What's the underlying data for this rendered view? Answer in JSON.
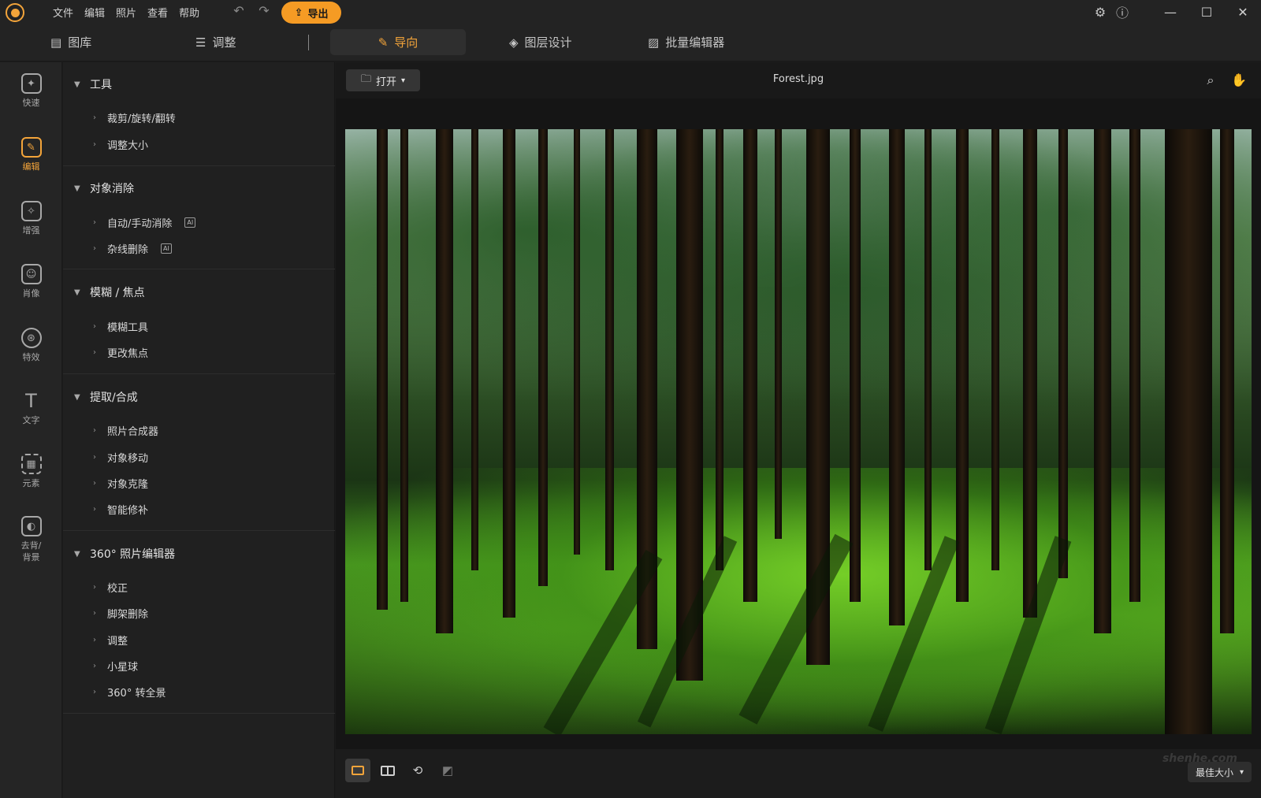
{
  "menu": {
    "items": [
      "文件",
      "编辑",
      "照片",
      "查看",
      "帮助"
    ],
    "export_label": "导出"
  },
  "tabs": [
    {
      "label": "图库",
      "icon": "library-icon"
    },
    {
      "label": "调整",
      "icon": "sliders-icon"
    },
    {
      "label": "导向",
      "icon": "magic-wand-icon",
      "active": true
    },
    {
      "label": "图层设计",
      "icon": "layers-icon"
    },
    {
      "label": "批量编辑器",
      "icon": "batch-images-icon"
    }
  ],
  "rail": [
    {
      "label": "快速",
      "icon": "quick-magic-icon"
    },
    {
      "label": "编辑",
      "icon": "edit-image-icon",
      "active": true
    },
    {
      "label": "增强",
      "icon": "enhance-icon"
    },
    {
      "label": "肖像",
      "icon": "portrait-icon"
    },
    {
      "label": "特效",
      "icon": "effects-icon"
    },
    {
      "label": "文字",
      "icon": "text-icon"
    },
    {
      "label": "元素",
      "icon": "elements-icon"
    },
    {
      "label": "去背/\n背景",
      "icon": "remove-background-icon"
    }
  ],
  "panel": {
    "sections": [
      {
        "title": "工具",
        "items": [
          {
            "label": "裁剪/旋转/翻转"
          },
          {
            "label": "调整大小"
          }
        ]
      },
      {
        "title": "对象消除",
        "items": [
          {
            "label": "自动/手动消除",
            "ai": true
          },
          {
            "label": "杂线删除",
            "ai": true
          }
        ]
      },
      {
        "title": "模糊 / 焦点",
        "items": [
          {
            "label": "模糊工具"
          },
          {
            "label": "更改焦点"
          }
        ]
      },
      {
        "title": "提取/合成",
        "items": [
          {
            "label": "照片合成器"
          },
          {
            "label": "对象移动"
          },
          {
            "label": "对象克隆"
          },
          {
            "label": "智能修补"
          }
        ]
      },
      {
        "title": "360° 照片编辑器",
        "items": [
          {
            "label": "校正"
          },
          {
            "label": "脚架删除"
          },
          {
            "label": "调整"
          },
          {
            "label": "小星球"
          },
          {
            "label": "360° 转全景"
          }
        ]
      }
    ],
    "ai_badge": "AI"
  },
  "workspace": {
    "open_label": "打开",
    "file_name": "Forest.jpg",
    "zoom_label": "最佳大小",
    "watermark": "shenhe.com"
  },
  "colors": {
    "accent": "#f3a43a",
    "export_button": "#f59b24"
  }
}
